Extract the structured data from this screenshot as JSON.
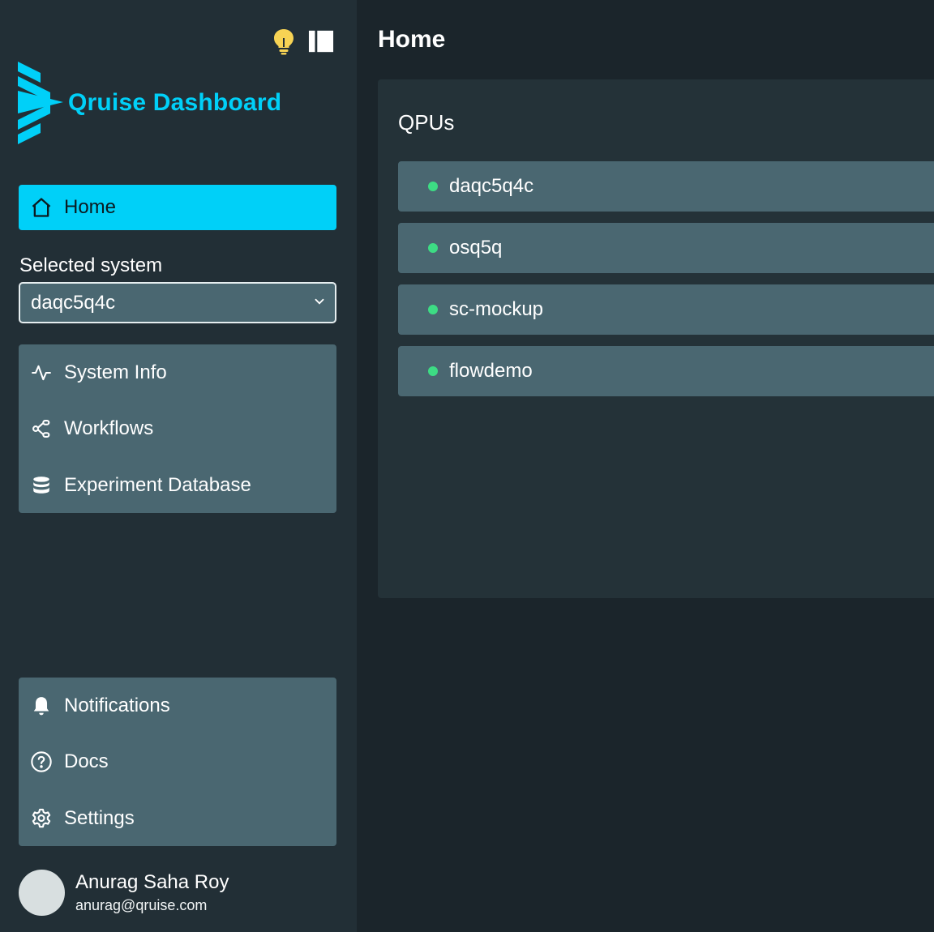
{
  "sidebar": {
    "brand": {
      "title": "Qruise Dashboard",
      "color": "#00d0f8"
    },
    "home_label": "Home",
    "selected_system_label": "Selected system",
    "selected_system_value": "daqc5q4c",
    "nav_primary": [
      {
        "label": "System Info",
        "icon": "activity-icon"
      },
      {
        "label": "Workflows",
        "icon": "workflow-icon"
      },
      {
        "label": "Experiment Database",
        "icon": "database-icon"
      }
    ],
    "nav_secondary": [
      {
        "label": "Notifications",
        "icon": "bell-icon"
      },
      {
        "label": "Docs",
        "icon": "help-circle-icon"
      },
      {
        "label": "Settings",
        "icon": "gear-icon"
      }
    ],
    "user": {
      "name": "Anurag Saha Roy",
      "email": "anurag@qruise.com"
    }
  },
  "main": {
    "title": "Home",
    "qpus_title": "QPUs",
    "qpus": [
      {
        "name": "daqc5q4c",
        "status_color": "#3ddc84"
      },
      {
        "name": "osq5q",
        "status_color": "#3ddc84"
      },
      {
        "name": "sc-mockup",
        "status_color": "#3ddc84"
      },
      {
        "name": "flowdemo",
        "status_color": "#3ddc84"
      }
    ]
  },
  "colors": {
    "accent": "#00d0f8",
    "sidebar_bg": "#222f36",
    "main_bg": "#1b252b",
    "card_bg": "#4a6771",
    "status_online": "#3ddc84",
    "bulb": "#f7d354"
  }
}
